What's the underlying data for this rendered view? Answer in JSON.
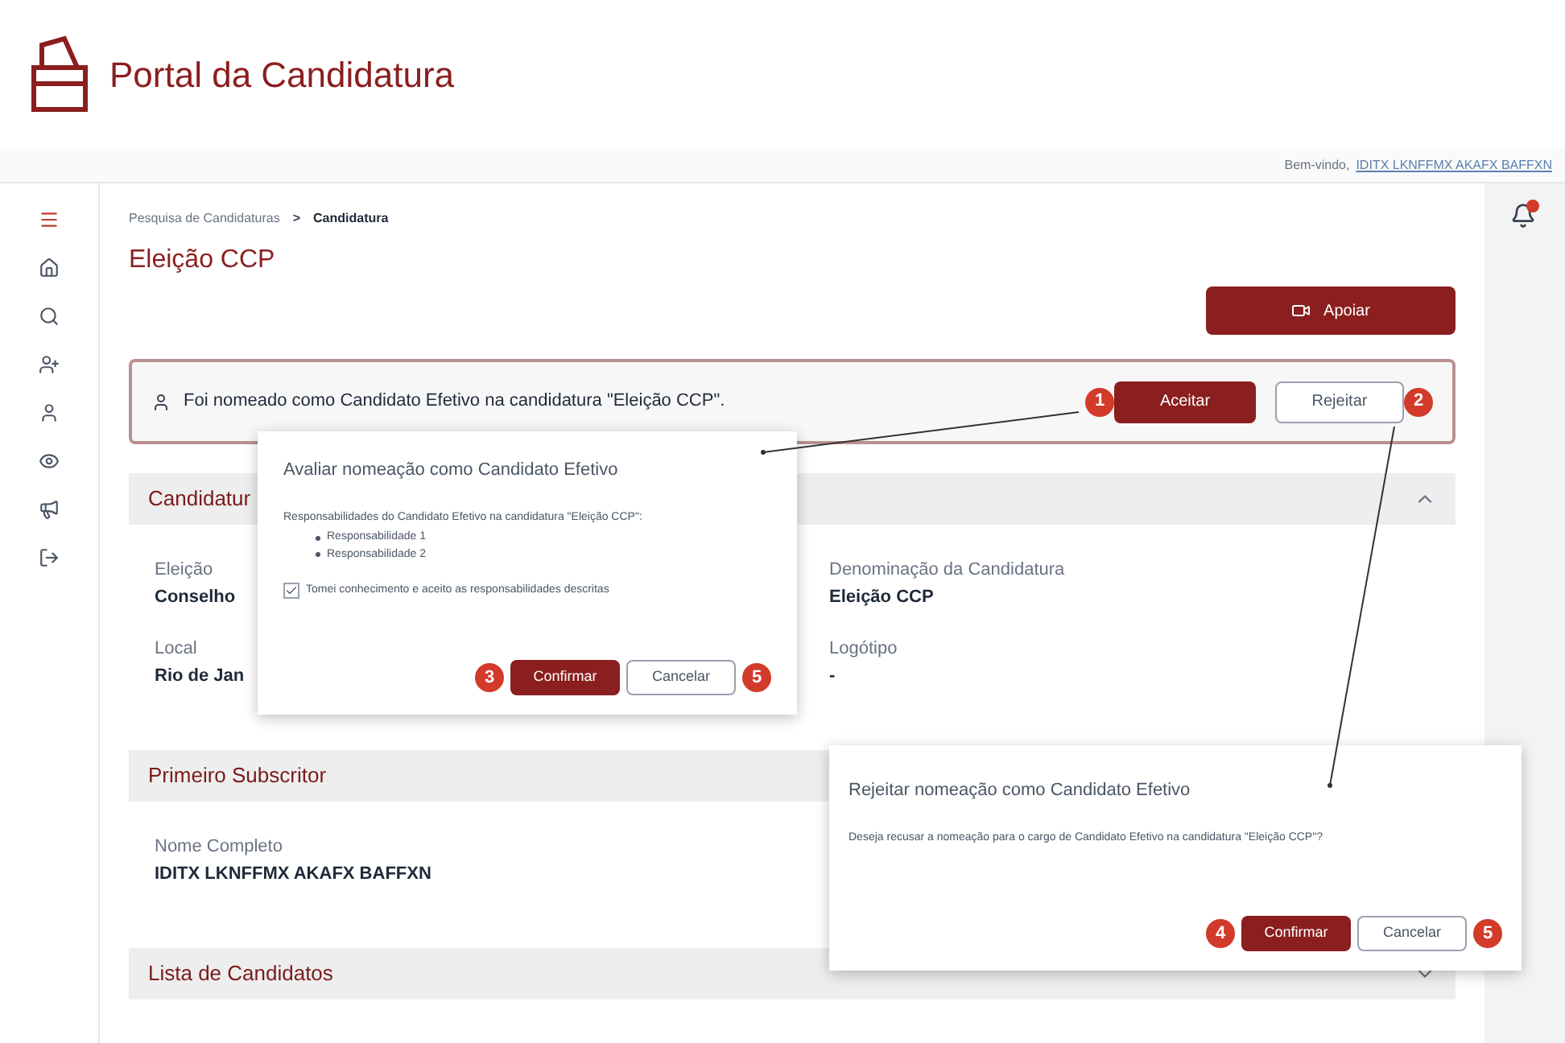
{
  "header": {
    "title": "Portal da Candidatura",
    "welcome": "Bem-vindo,",
    "user": "IDITX LKNFFMX AKAFX BAFFXN"
  },
  "sidebar": {
    "items": [
      {
        "kind": "menu",
        "selected": true
      },
      {
        "kind": "home",
        "selected": false
      },
      {
        "kind": "search",
        "selected": false
      },
      {
        "kind": "user-plus",
        "selected": false
      },
      {
        "kind": "person",
        "selected": false
      },
      {
        "kind": "eye",
        "selected": false
      },
      {
        "kind": "megaphone",
        "selected": false
      },
      {
        "kind": "sign-out",
        "selected": false
      }
    ]
  },
  "notifications": {
    "unread": true
  },
  "breadcrumb": [
    {
      "label": "Pesquisa de Candidaturas"
    },
    {
      "label": "Candidatura"
    }
  ],
  "breadcrumb_separator": ">",
  "page_title": "Eleição CCP",
  "support_button": "Apoiar",
  "alert": {
    "message": "Foi nomeado como Candidato Efetivo na candidatura \"Eleição CCP\".",
    "accept": {
      "label": "Aceitar",
      "step": "1"
    },
    "reject": {
      "label": "Rejeitar",
      "step": "2"
    }
  },
  "sections": [
    {
      "title": "Candidatur",
      "expanded": true,
      "fields": [
        {
          "label": "Eleição",
          "value": "Conselho"
        },
        {
          "label": "Denominação da Candidatura",
          "value": "Eleição CCP"
        },
        {
          "label": "Local",
          "value": "Rio de Jan"
        },
        {
          "label": "Logótipo",
          "value": "-"
        }
      ]
    },
    {
      "title": "Primeiro Subscritor",
      "fields": [
        {
          "label": "Nome Completo",
          "value": "IDITX LKNFFMX AKAFX BAFFXN"
        }
      ]
    },
    {
      "title": "Lista de Candidatos",
      "expanded": false
    }
  ],
  "accept_dialog": {
    "title": "Avaliar nomeação como Candidato Efetivo",
    "intro": "Responsabilidades do Candidato Efetivo na candidatura \"Eleição CCP\":",
    "items": [
      "Responsabilidade 1",
      "Responsabilidade 2"
    ],
    "checkbox": {
      "label": "Tomei conhecimento e aceito as responsabilidades descritas",
      "checked": true
    },
    "confirm": {
      "label": "Confirmar",
      "step": "3"
    },
    "cancel": {
      "label": "Cancelar",
      "step": "5"
    }
  },
  "reject_dialog": {
    "title": "Rejeitar nomeação como Candidato Efetivo",
    "message": "Deseja recusar a nomeação para o cargo de Candidato Efetivo na candidatura \"Eleição CCP\"?",
    "confirm": {
      "label": "Confirmar",
      "step": "4"
    },
    "cancel": {
      "label": "Cancelar",
      "step": "5"
    }
  }
}
